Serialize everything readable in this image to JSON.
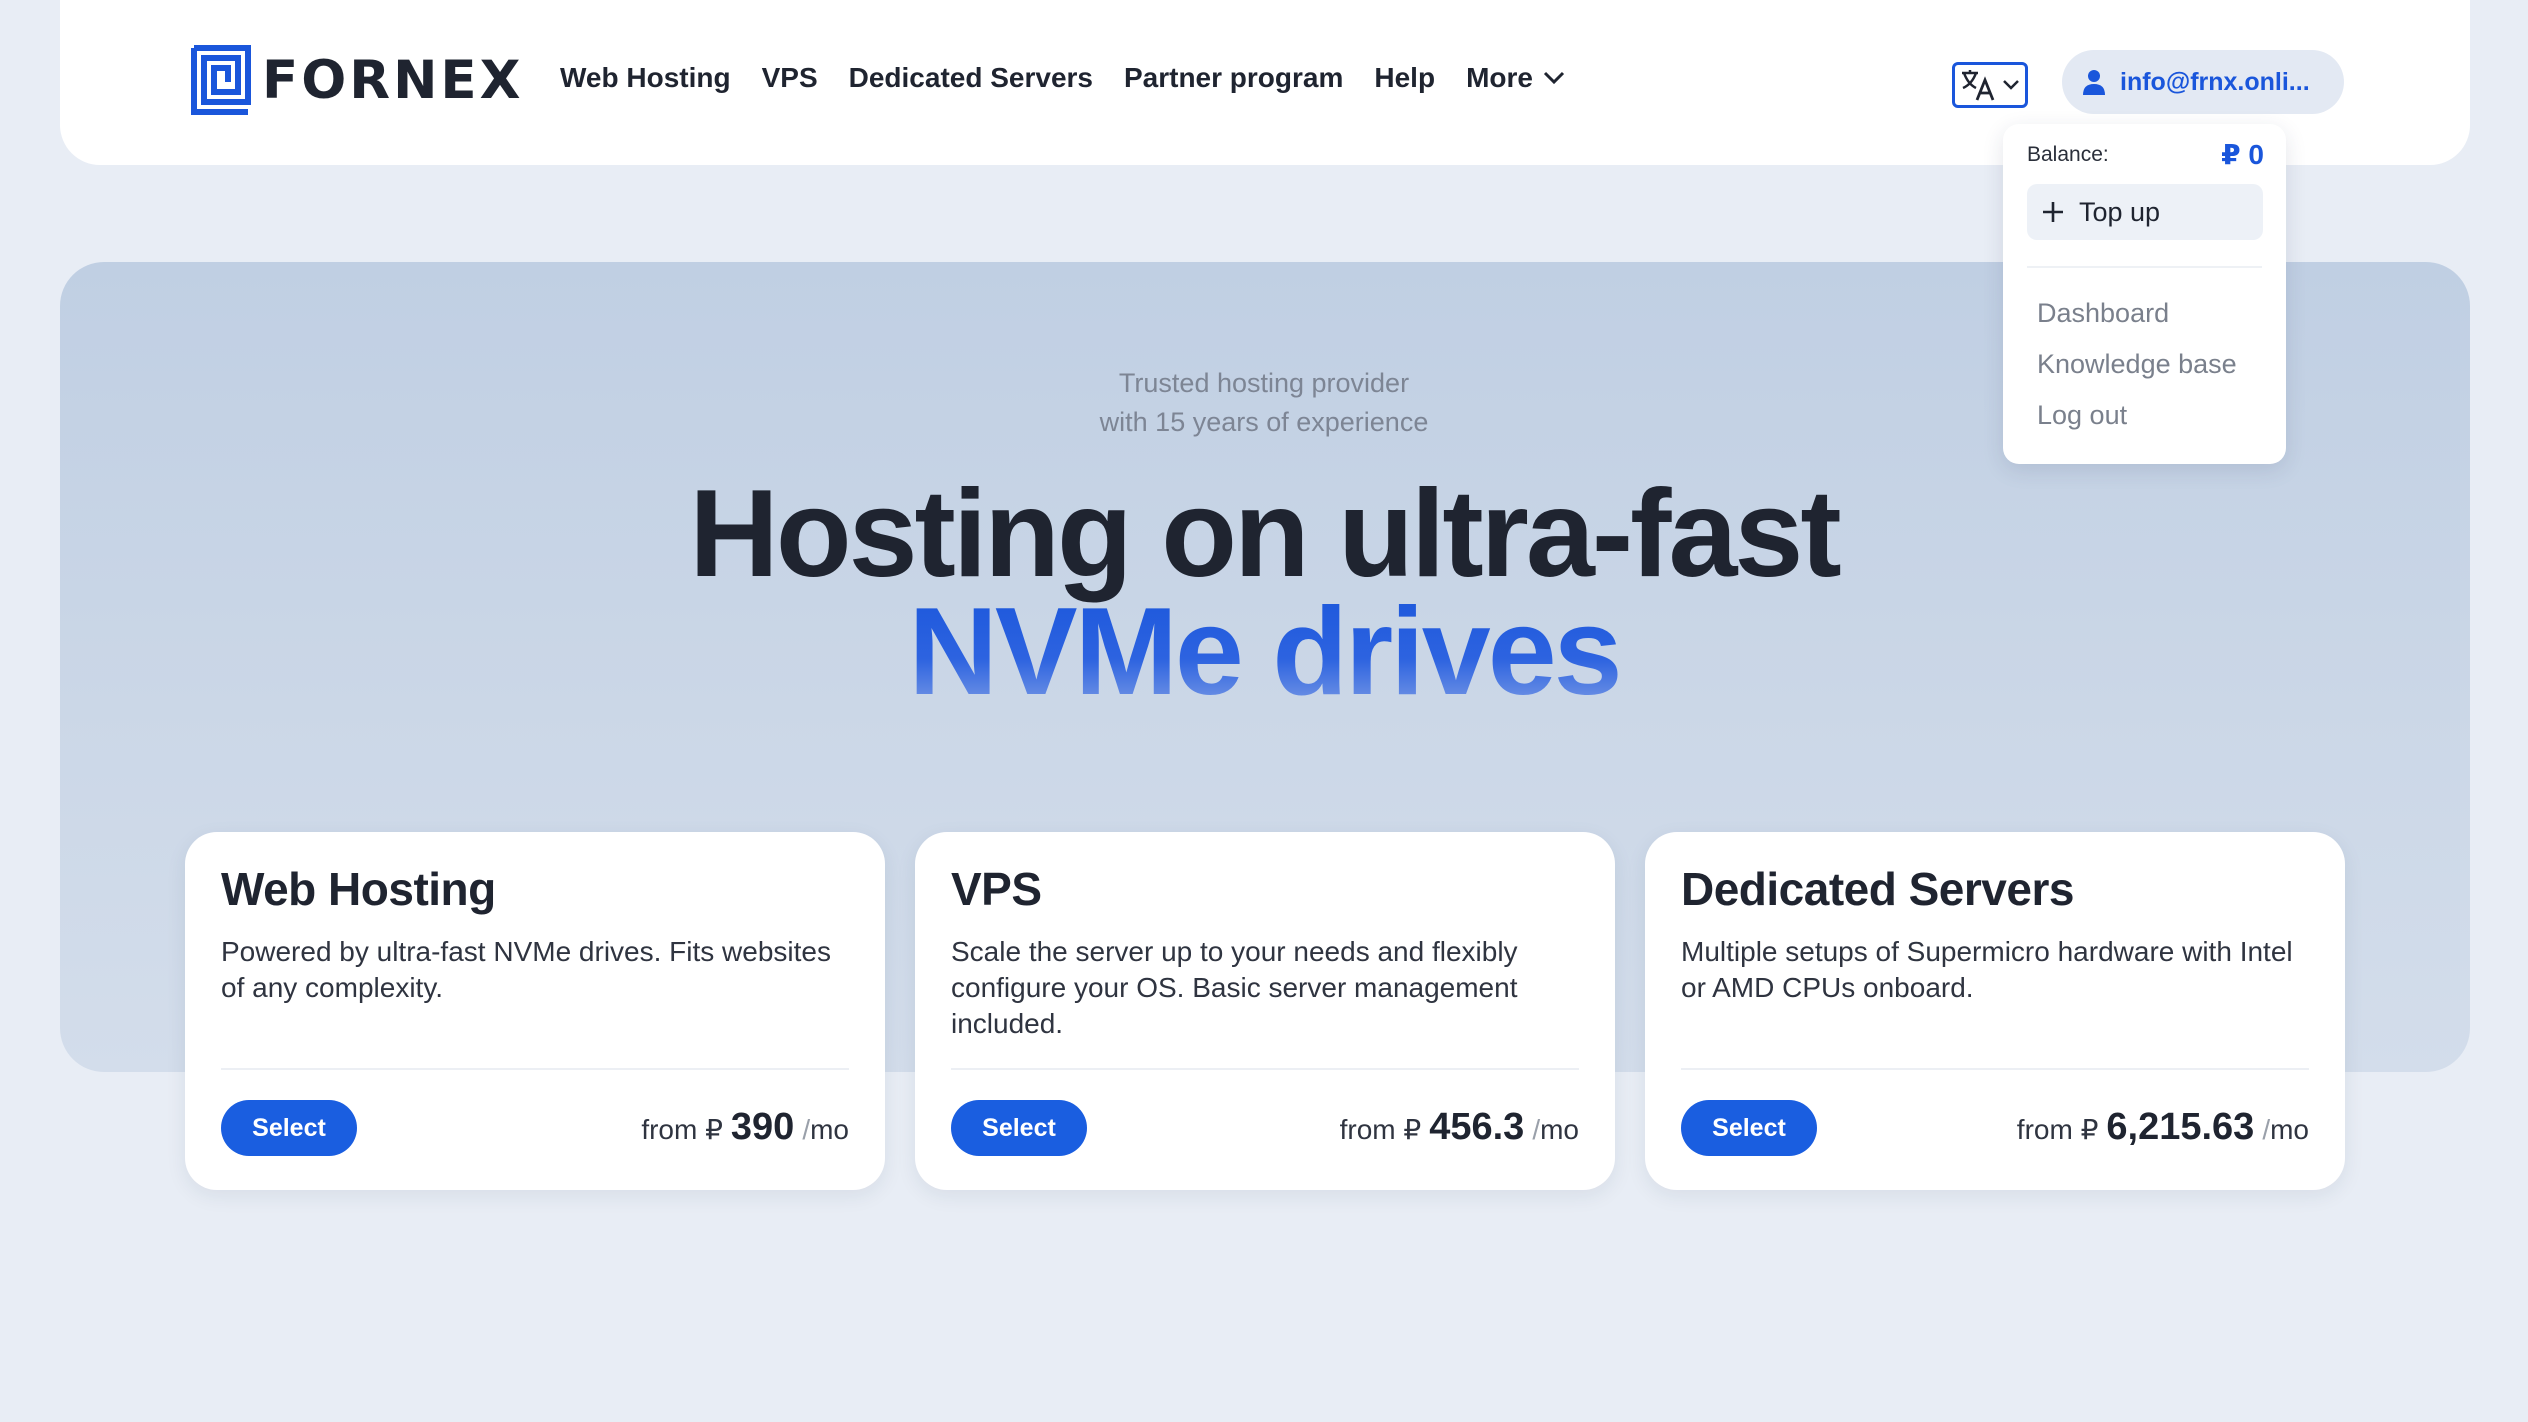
{
  "header": {
    "logo_text": "FORNEX",
    "nav": [
      {
        "label": "Web Hosting"
      },
      {
        "label": "VPS"
      },
      {
        "label": "Dedicated Servers"
      },
      {
        "label": "Partner program"
      },
      {
        "label": "Help"
      },
      {
        "label": "More"
      }
    ],
    "language_icon": "translate-icon",
    "account_email": "info@frnx.onli..."
  },
  "account_menu": {
    "balance_label": "Balance:",
    "balance_value": "₽ 0",
    "topup_label": "Top up",
    "items": [
      {
        "label": "Dashboard"
      },
      {
        "label": "Knowledge base"
      },
      {
        "label": "Log out"
      }
    ]
  },
  "hero": {
    "tagline_line1": "Trusted hosting provider",
    "tagline_line2": "with 15 years of experience",
    "headline_line1": "Hosting on ultra-fast",
    "headline_line2": "NVMe drives"
  },
  "cards": [
    {
      "title": "Web Hosting",
      "description": "Powered by ultra-fast NVMe drives. Fits websites of any complexity.",
      "button": "Select",
      "price_prefix": "from ₽",
      "price": "390",
      "price_suffix": "mo"
    },
    {
      "title": "VPS",
      "description": "Scale the server up to your needs and flexibly configure your OS. Basic server management included.",
      "button": "Select",
      "price_prefix": "from ₽",
      "price": "456.3",
      "price_suffix": "mo"
    },
    {
      "title": "Dedicated Servers",
      "description": "Multiple setups of Supermicro hardware with Intel or AMD CPUs onboard.",
      "button": "Select",
      "price_prefix": "from ₽",
      "price": "6,215.63",
      "price_suffix": "mo"
    }
  ],
  "colors": {
    "accent": "#1a56db",
    "background": "#e8edf5",
    "text": "#1f2430"
  }
}
